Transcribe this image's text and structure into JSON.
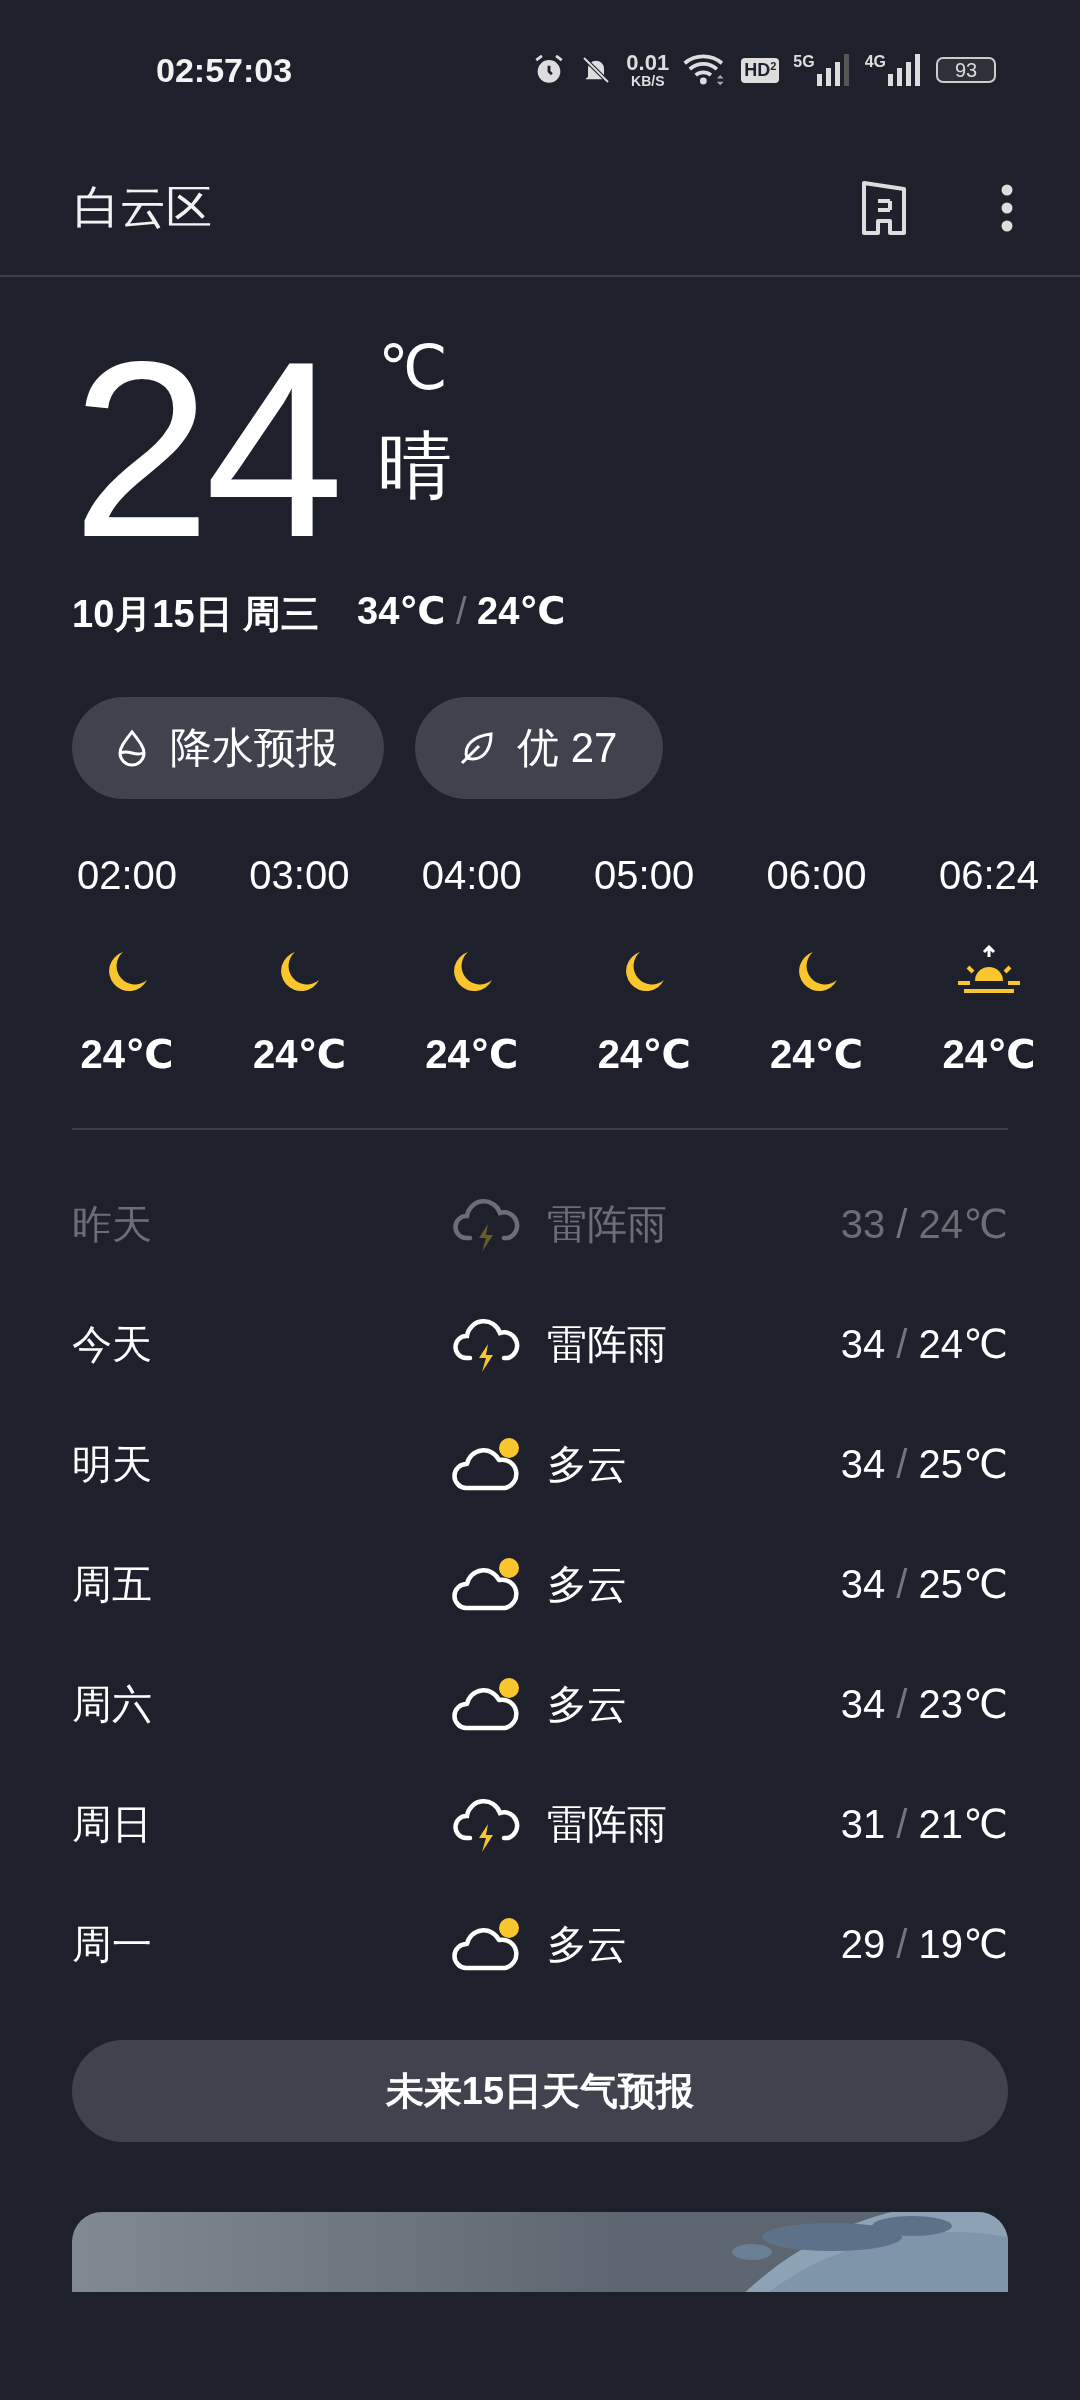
{
  "status_bar": {
    "time": "02:57:03",
    "speed_value": "0.01",
    "speed_unit": "KB/S",
    "hd": "HD",
    "hd_sub": "2",
    "net1": "5G",
    "net2": "4G",
    "battery": "93"
  },
  "header": {
    "location": "白云区"
  },
  "current": {
    "temp": "24",
    "unit": "℃",
    "condition": "晴",
    "date": "10月15日 周三",
    "high": "34℃",
    "sep": "/",
    "low": "24℃"
  },
  "chips": [
    {
      "kind": "rain",
      "label": "降水预报"
    },
    {
      "kind": "air",
      "label": "优 27"
    }
  ],
  "hourly": [
    {
      "time": "02:00",
      "kind": "moon",
      "temp": "24℃"
    },
    {
      "time": "03:00",
      "kind": "moon",
      "temp": "24℃"
    },
    {
      "time": "04:00",
      "kind": "moon",
      "temp": "24℃"
    },
    {
      "time": "05:00",
      "kind": "moon",
      "temp": "24℃"
    },
    {
      "time": "06:00",
      "kind": "moon",
      "temp": "24℃"
    },
    {
      "time": "06:24",
      "kind": "sunrise",
      "temp": "24℃"
    }
  ],
  "daily": [
    {
      "day": "昨天",
      "kind": "thunder",
      "condition": "雷阵雨",
      "high": "33",
      "sep": "/",
      "low": "24℃",
      "past": true
    },
    {
      "day": "今天",
      "kind": "thunder",
      "condition": "雷阵雨",
      "high": "34",
      "sep": "/",
      "low": "24℃",
      "past": false
    },
    {
      "day": "明天",
      "kind": "cloudy",
      "condition": "多云",
      "high": "34",
      "sep": "/",
      "low": "25℃",
      "past": false
    },
    {
      "day": "周五",
      "kind": "cloudy",
      "condition": "多云",
      "high": "34",
      "sep": "/",
      "low": "25℃",
      "past": false
    },
    {
      "day": "周六",
      "kind": "cloudy",
      "condition": "多云",
      "high": "34",
      "sep": "/",
      "low": "23℃",
      "past": false
    },
    {
      "day": "周日",
      "kind": "thunder",
      "condition": "雷阵雨",
      "high": "31",
      "sep": "/",
      "low": "21℃",
      "past": false
    },
    {
      "day": "周一",
      "kind": "cloudy",
      "condition": "多云",
      "high": "29",
      "sep": "/",
      "low": "19℃",
      "past": false
    }
  ],
  "forecast_button": {
    "label": "未来15日天气预报"
  }
}
